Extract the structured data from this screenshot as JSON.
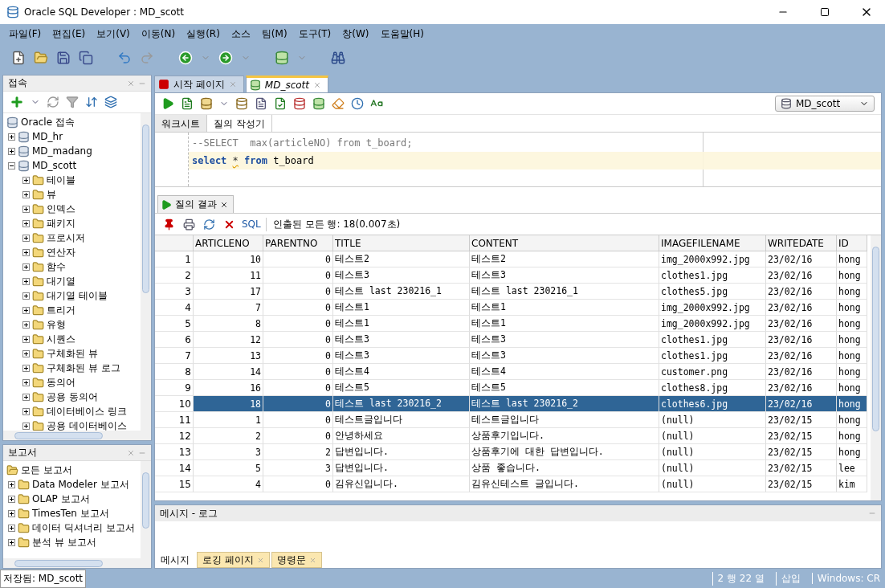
{
  "window": {
    "title": "Oracle SQL Developer : MD_scott"
  },
  "menu": [
    "파일(F)",
    "편집(E)",
    "보기(V)",
    "이동(N)",
    "실행(R)",
    "소스",
    "팀(M)",
    "도구(T)",
    "창(W)",
    "도움말(H)"
  ],
  "connections": {
    "title": "접속",
    "root": "Oracle 접속",
    "items": [
      {
        "label": "MD_hr",
        "expanded": false
      },
      {
        "label": "MD_madang",
        "expanded": false
      },
      {
        "label": "MD_scott",
        "expanded": true,
        "children": [
          {
            "label": "테이블",
            "expanded": false
          },
          {
            "label": "뷰",
            "expanded": false
          },
          {
            "label": "인덱스",
            "expanded": false
          },
          {
            "label": "패키지",
            "expanded": false
          },
          {
            "label": "프로시저",
            "expanded": false
          },
          {
            "label": "연산자",
            "expanded": false
          },
          {
            "label": "함수",
            "expanded": false
          },
          {
            "label": "대기열",
            "expanded": false
          },
          {
            "label": "대기열 테이블",
            "expanded": false
          },
          {
            "label": "트리거",
            "expanded": false
          },
          {
            "label": "유형",
            "expanded": false
          },
          {
            "label": "시퀀스",
            "expanded": false
          },
          {
            "label": "구체화된 뷰",
            "expanded": false
          },
          {
            "label": "구체화된 뷰 로그",
            "expanded": false
          },
          {
            "label": "동의어",
            "expanded": false
          },
          {
            "label": "공용 동의어",
            "expanded": false
          },
          {
            "label": "데이터베이스 링크",
            "expanded": false
          },
          {
            "label": "공용 데이터베이스",
            "expanded": false
          }
        ]
      }
    ]
  },
  "reports": {
    "title": "보고서",
    "root": "모든 보고서",
    "items": [
      {
        "label": "Data Modeler 보고서",
        "expanded": false
      },
      {
        "label": "OLAP 보고서",
        "expanded": false
      },
      {
        "label": "TimesTen 보고서",
        "expanded": false
      },
      {
        "label": "데이터 딕셔너리 보고서",
        "expanded": false
      },
      {
        "label": "분석 뷰 보고서",
        "expanded": false
      }
    ]
  },
  "editor_tabs": [
    {
      "label": "시작 페이지",
      "selected": false,
      "kind": "start"
    },
    {
      "label": "MD_scott",
      "selected": true,
      "kind": "sql"
    }
  ],
  "connection_select": {
    "value": "MD_scott"
  },
  "worksheet_tabs": [
    {
      "label": "워크시트",
      "selected": true
    },
    {
      "label": "질의 작성기",
      "selected": false
    }
  ],
  "editor": {
    "lines": [
      {
        "current": false,
        "tokens": [
          {
            "kind": "comment",
            "text": "--SELECT  max(articleNO) from t_board;"
          }
        ]
      },
      {
        "current": true,
        "tokens": [
          {
            "kind": "keyword",
            "text": "select"
          },
          {
            "kind": "warning",
            "text": "*"
          },
          {
            "kind": "keyword",
            "text": "from"
          },
          {
            "kind": "plain",
            "text": "t_board"
          }
        ]
      }
    ]
  },
  "results": {
    "tab": "질의 결과",
    "sql_link": "SQL",
    "status": "인출된 모든 행: 18(0.007초)",
    "columns": [
      {
        "label": "ARTICLENO",
        "kind": "number"
      },
      {
        "label": "PARENTNO",
        "kind": "number"
      },
      {
        "label": "TITLE",
        "kind": "text"
      },
      {
        "label": "CONTENT",
        "kind": "text"
      },
      {
        "label": "IMAGEFILENAME",
        "kind": "text"
      },
      {
        "label": "WRITEDATE",
        "kind": "text"
      },
      {
        "label": "ID",
        "kind": "text"
      }
    ],
    "rows": [
      {
        "number": "1",
        "selected": false,
        "cells": [
          "10",
          "0",
          "테스트2",
          "테스트2",
          "img_2000x992.jpg",
          "23/02/16",
          "hong"
        ]
      },
      {
        "number": "2",
        "selected": false,
        "cells": [
          "11",
          "0",
          "테스트3",
          "테스트3",
          "clothes1.jpg",
          "23/02/16",
          "hong"
        ]
      },
      {
        "number": "3",
        "selected": false,
        "cells": [
          "17",
          "0",
          "테스트 last 230216_1",
          "테스트 last 230216_1",
          "clothes5.jpg",
          "23/02/16",
          "hong"
        ]
      },
      {
        "number": "4",
        "selected": false,
        "cells": [
          "7",
          "0",
          "테스트1",
          "테스트1",
          "img_2000x992.jpg",
          "23/02/16",
          "hong"
        ]
      },
      {
        "number": "5",
        "selected": false,
        "cells": [
          "8",
          "0",
          "테스트1",
          "테스트1",
          "img_2000x992.jpg",
          "23/02/16",
          "hong"
        ]
      },
      {
        "number": "6",
        "selected": false,
        "cells": [
          "12",
          "0",
          "테스트3",
          "테스트3",
          "clothes1.jpg",
          "23/02/16",
          "hong"
        ]
      },
      {
        "number": "7",
        "selected": false,
        "cells": [
          "13",
          "0",
          "테스트3",
          "테스트3",
          "clothes1.jpg",
          "23/02/16",
          "hong"
        ]
      },
      {
        "number": "8",
        "selected": false,
        "cells": [
          "14",
          "0",
          "테스트4",
          "테스트4",
          "customer.png",
          "23/02/16",
          "hong"
        ]
      },
      {
        "number": "9",
        "selected": false,
        "cells": [
          "16",
          "0",
          "테스트5",
          "테스트5",
          "clothes8.jpg",
          "23/02/16",
          "hong"
        ]
      },
      {
        "number": "10",
        "selected": true,
        "cells": [
          "18",
          "0",
          "테스트 last 230216_2",
          "테스트 last 230216_2",
          "clothes6.jpg",
          "23/02/16",
          "hong"
        ]
      },
      {
        "number": "11",
        "selected": false,
        "cells": [
          "1",
          "0",
          "테스트글입니다",
          "테스트글입니다",
          "(null)",
          "23/02/15",
          "hong"
        ]
      },
      {
        "number": "12",
        "selected": false,
        "cells": [
          "2",
          "0",
          "안녕하세요",
          "상품후기입니다.",
          "(null)",
          "23/02/15",
          "hong"
        ]
      },
      {
        "number": "13",
        "selected": false,
        "cells": [
          "3",
          "2",
          "답변입니다.",
          "상품후기에 대한 답변입니다.",
          "(null)",
          "23/02/15",
          "hong"
        ]
      },
      {
        "number": "14",
        "selected": false,
        "cells": [
          "5",
          "3",
          "답변입니다.",
          "상품 좋습니다.",
          "(null)",
          "23/02/15",
          "lee"
        ]
      },
      {
        "number": "15",
        "selected": false,
        "cells": [
          "4",
          "0",
          "김유신입니다.",
          "김유신테스트 글입니다.",
          "(null)",
          "23/02/15",
          "kim"
        ]
      }
    ]
  },
  "log": {
    "title": "메시지 - 로그",
    "tabs": [
      {
        "label": "메시지",
        "selected": true,
        "closable": false
      },
      {
        "label": "로깅 페이지",
        "selected": false,
        "closable": true
      },
      {
        "label": "명령문",
        "selected": false,
        "closable": true
      }
    ]
  },
  "status_bar": {
    "saved": "저장됨: MD_scott",
    "position": "2 행 22 열",
    "mode": "삽입",
    "encoding": "Windows: CR"
  }
}
